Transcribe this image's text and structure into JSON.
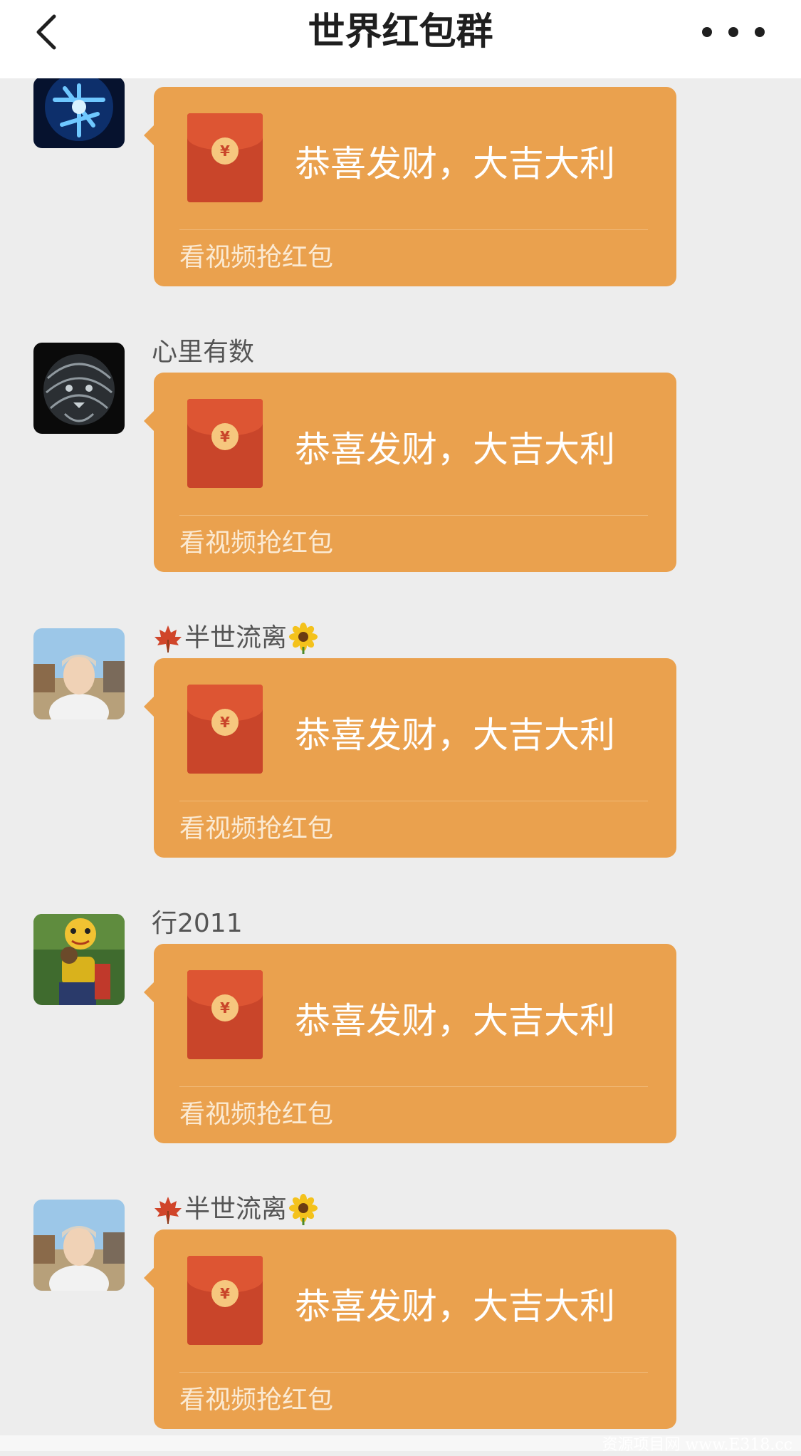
{
  "nav": {
    "title": "世界红包群"
  },
  "messages": [
    {
      "sender": "",
      "envelope_symbol": "¥",
      "greeting": "恭喜发财，大吉大利",
      "footer": "看视频抢红包"
    },
    {
      "sender": "心里有数",
      "envelope_symbol": "¥",
      "greeting": "恭喜发财，大吉大利",
      "footer": "看视频抢红包"
    },
    {
      "sender": "半世流离",
      "sender_prefix_icon": "maple-leaf-icon",
      "sender_suffix_icon": "sunflower-icon",
      "envelope_symbol": "¥",
      "greeting": "恭喜发财，大吉大利",
      "footer": "看视频抢红包"
    },
    {
      "sender": "行2011",
      "envelope_symbol": "¥",
      "greeting": "恭喜发财，大吉大利",
      "footer": "看视频抢红包"
    },
    {
      "sender": "半世流离",
      "sender_prefix_icon": "maple-leaf-icon",
      "sender_suffix_icon": "sunflower-icon",
      "envelope_symbol": "¥",
      "greeting": "恭喜发财，大吉大利",
      "footer": "看视频抢红包"
    }
  ],
  "watermark": "资源项目网 www.E318.cc",
  "colors": {
    "bubble": "#eaa14e",
    "envelope": "#c9452a",
    "envelope_flap": "#dd5533",
    "coin": "#f6c77e",
    "background": "#ededed"
  }
}
